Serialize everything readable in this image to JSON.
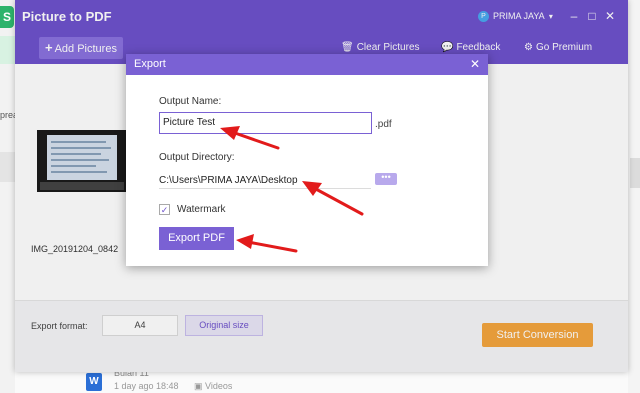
{
  "background": {
    "logo_glyph": "S",
    "left_fragment": "prea",
    "doc_icon_glyph": "W",
    "doc_title": "Bulan 11",
    "doc_meta_time": "1 day ago 18:48",
    "doc_meta_folder": "Videos"
  },
  "app": {
    "title": "Picture to PDF",
    "user_name": "PRIMA JAYA",
    "user_initial": "P",
    "win_controls": {
      "minimize": "–",
      "restore": "□",
      "close": "✕"
    }
  },
  "toolbar": {
    "add_label": "Add Pictures",
    "clear_label": "Clear Pictures",
    "feedback_label": "Feedback",
    "premium_label": "Go Premium"
  },
  "content": {
    "thumb_name": "IMG_20191204_0842"
  },
  "footer": {
    "format_label": "Export format:",
    "format_a4": "A4",
    "format_original": "Original size",
    "start_label": "Start Conversion"
  },
  "dialog": {
    "title": "Export",
    "close": "✕",
    "output_name_label": "Output Name:",
    "output_name_value": "Picture Test",
    "extension": ".pdf",
    "output_dir_label": "Output Directory:",
    "output_dir_value": "C:\\Users\\PRIMA JAYA\\Desktop",
    "browse_label": "•••",
    "watermark_label": "Watermark",
    "watermark_checked": true,
    "check_glyph": "✓",
    "export_label": "Export PDF"
  },
  "colors": {
    "brand_purple": "#6e52cc",
    "dialog_header": "#7a61d4",
    "start_orange": "#f4a53e",
    "annotation_red": "#e21b1b"
  }
}
